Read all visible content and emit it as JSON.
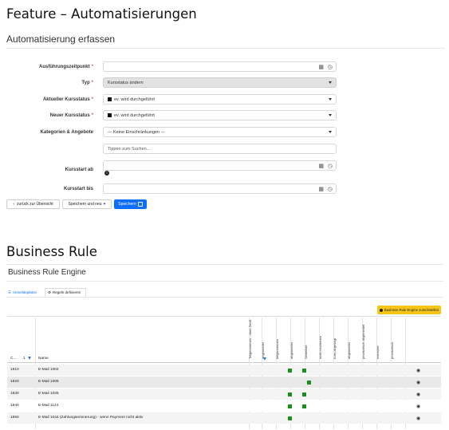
{
  "feature_heading": "Feature – Automatisierungen",
  "form": {
    "title": "Automatisierung erfassen",
    "fields": {
      "zeitpunkt": {
        "label": "Ausführungszeitpunkt",
        "required": "*",
        "value": ""
      },
      "typ": {
        "label": "Typ",
        "required": "*",
        "value": "Kursstatus ändern"
      },
      "aktueller": {
        "label": "Aktueller Kursstatus",
        "required": "*",
        "value": "ev. wird durchgeführt"
      },
      "neuer": {
        "label": "Neuer Kursstatus",
        "required": "*",
        "value": "ev. wird durchgeführt"
      },
      "kategorien": {
        "label": "Kategorien & Angebote",
        "value": "--- Keine Einschränkungen ---",
        "search_placeholder": "Tippen zum Suchen..."
      },
      "kursstart_ab": {
        "label": "Kursstart ab",
        "value": ""
      },
      "kursstart_bis": {
        "label": "Kursstart bis",
        "value": ""
      }
    },
    "buttons": {
      "back": "zurück zur Übersicht",
      "save_new": "Speichern und neu",
      "save": "Speichern"
    }
  },
  "business_heading": "Business Rule",
  "bre": {
    "title": "Business Rule Engine",
    "tabs": [
      "Anmeldeplätze",
      "Regeln definieren"
    ],
    "deactivate_label": "Business Rule Engine zurückstellen",
    "col_id": "C...",
    "col_id_sort": "1",
    "col_name": "Name",
    "rotated_headers": [
      "Teilgenommen - ohne Zertif.",
      "angemeldet",
      "teilgenommen",
      "abgemeldet",
      "Warteliste",
      "nicht erschienen",
      "Kurs abgesagt",
      "abgemeldet",
      "provisorisch abgemeldet",
      "reserviert",
      "provisorisch"
    ],
    "rows": [
      {
        "id": "1810",
        "name": "E-Mail 1004",
        "checks": [
          1,
          2
        ]
      },
      {
        "id": "1820",
        "name": "E-Mail 1005",
        "checks": [
          4
        ]
      },
      {
        "id": "1830",
        "name": "E-Mail 1025",
        "checks": [
          1,
          2
        ]
      },
      {
        "id": "1840",
        "name": "E-Mail 1124",
        "checks": [
          1,
          2
        ]
      },
      {
        "id": "1850",
        "name": "E-Mail 1044 (Zahlungserinnerung) - wenn Payment nicht aktiv",
        "checks": [
          1
        ]
      }
    ],
    "colors": {
      "check": "#1a8f1a",
      "primary": "#0d6efd",
      "warning": "#f5c518"
    }
  }
}
